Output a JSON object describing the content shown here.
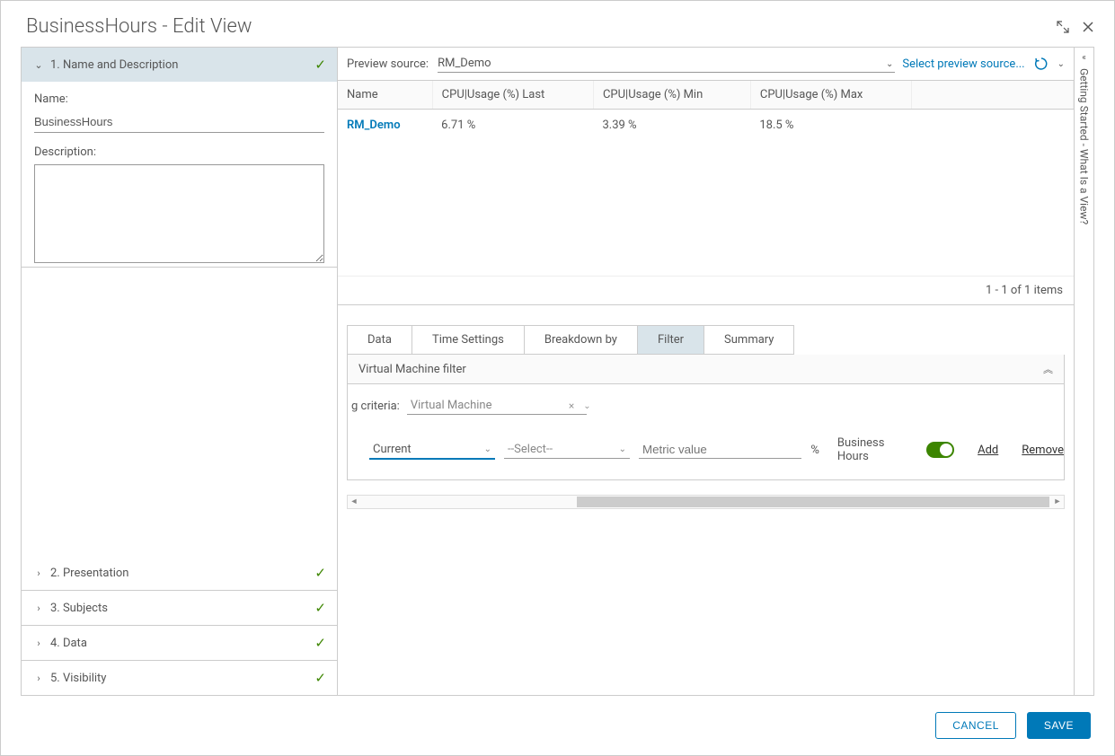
{
  "header": {
    "title": "BusinessHours - Edit View"
  },
  "steps": {
    "s1": {
      "title": "1. Name and Description"
    },
    "s2": {
      "title": "2. Presentation"
    },
    "s3": {
      "title": "3. Subjects"
    },
    "s4": {
      "title": "4. Data"
    },
    "s5": {
      "title": "5. Visibility"
    }
  },
  "form": {
    "name_label": "Name:",
    "name_value": "BusinessHours",
    "desc_label": "Description:",
    "desc_value": ""
  },
  "preview": {
    "label": "Preview source:",
    "value": "RM_Demo",
    "select_link": "Select preview source...",
    "columns": {
      "c0": "Name",
      "c1": "CPU|Usage (%) Last",
      "c2": "CPU|Usage (%) Min",
      "c3": "CPU|Usage (%) Max"
    },
    "row": {
      "name": "RM_Demo",
      "last": "6.71 %",
      "min": "3.39 %",
      "max": "18.5 %"
    },
    "footer": "1 - 1 of 1 items"
  },
  "tabs": {
    "data": "Data",
    "time": "Time Settings",
    "breakdown": "Breakdown by",
    "filter": "Filter",
    "summary": "Summary"
  },
  "filter": {
    "panel_title": "Virtual Machine filter",
    "criteria_label": "g criteria:",
    "criteria_value": "Virtual Machine",
    "current": "Current",
    "select_placeholder": "--Select--",
    "metric_placeholder": "Metric value",
    "pct": "%",
    "bh_label": "Business Hours",
    "add": "Add",
    "remove": "Remove"
  },
  "rail": {
    "text": "Getting Started - What Is a View?"
  },
  "buttons": {
    "cancel": "CANCEL",
    "save": "SAVE"
  }
}
